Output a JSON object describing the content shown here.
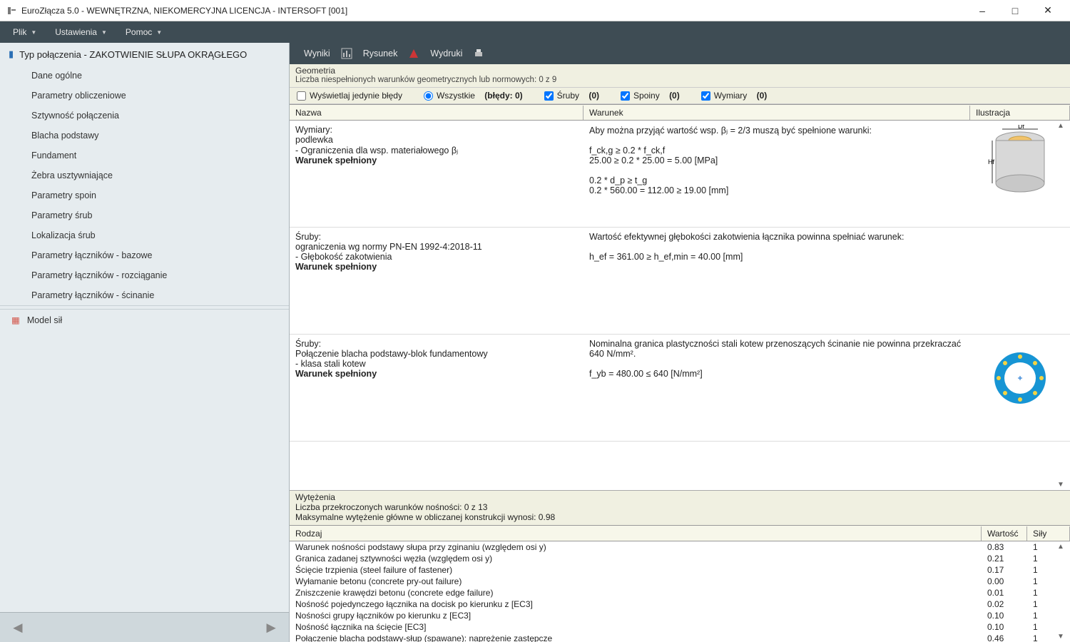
{
  "window": {
    "title": "EuroZłącza 5.0 - WEWNĘTRZNA, NIEKOMERCYJNA LICENCJA - INTERSOFT [001]"
  },
  "menubar": {
    "file": "Plik",
    "settings": "Ustawienia",
    "help": "Pomoc"
  },
  "sidebar": {
    "header": "Typ połączenia - ZAKOTWIENIE SŁUPA OKRĄGŁEGO",
    "items": [
      "Dane ogólne",
      "Parametry obliczeniowe",
      "Sztywność połączenia",
      "Blacha podstawy",
      "Fundament",
      "Żebra usztywniające",
      "Parametry spoin",
      "Parametry śrub",
      "Lokalizacja śrub",
      "Parametry łączników - bazowe",
      "Parametry łączników - rozciąganie",
      "Parametry łączników - ścinanie"
    ],
    "model": "Model sił"
  },
  "toolbar": {
    "results": "Wyniki",
    "drawing": "Rysunek",
    "printouts": "Wydruki"
  },
  "geometry": {
    "title": "Geometria",
    "unmet": "Liczba niespełnionych warunków geometrycznych lub normowych: 0 z 9"
  },
  "filters": {
    "errors_only": "Wyświetlaj jedynie błędy",
    "all": "Wszystkie",
    "errors_count": "(błędy: 0)",
    "bolts": "Śruby",
    "bolts_c": "(0)",
    "welds": "Spoiny",
    "welds_c": "(0)",
    "dims": "Wymiary",
    "dims_c": "(0)"
  },
  "columns": {
    "name": "Nazwa",
    "cond": "Warunek",
    "ill": "Ilustracja"
  },
  "rows": [
    {
      "name": "Wymiary:\npodlewka\n- Ograniczenia dla wsp. materiałowego βⱼ",
      "name_bold": "Warunek spełniony",
      "cond": "Aby można przyjąć wartość wsp. βⱼ = 2/3 muszą być spełnione warunki:\n\nf_ck,g ≥ 0.2 * f_ck,f\n25.00 ≥ 0.2 * 25.00 = 5.00 [MPa]\n\n0.2 * d_p ≥ t_g\n0.2 * 560.00 = 112.00 ≥ 19.00 [mm]",
      "ill": "cylinder"
    },
    {
      "name": "Śruby:\nograniczenia wg normy PN-EN 1992-4:2018-11\n- Głębokość zakotwienia",
      "name_bold": "Warunek spełniony",
      "cond": "Wartość efektywnej głębokości zakotwienia łącznika powinna spełniać warunek:\n\nh_ef = 361.00 ≥ h_ef,min = 40.00 [mm]",
      "ill": ""
    },
    {
      "name": "Śruby:\nPołączenie blacha podstawy-blok fundamentowy\n- klasa stali kotew",
      "name_bold": "Warunek spełniony",
      "cond": "Nominalna granica plastyczności stali kotew przenoszących ścinanie nie powinna przekraczać 640 N/mm².\n\nf_yb = 480.00 ≤ 640 [N/mm²]",
      "ill": "ring"
    }
  ],
  "wytezenia": {
    "title": "Wytężenia",
    "sub1": "Liczba przekroczonych warunków nośności: 0 z 13",
    "sub2": "Maksymalne wytężenie główne w obliczanej konstrukcji wynosi: 0.98",
    "col_r": "Rodzaj",
    "col_w": "Wartość",
    "col_s": "Siły",
    "rows": [
      {
        "r": "Warunek nośności podstawy słupa przy zginaniu (względem osi y)",
        "w": "0.83",
        "s": "1"
      },
      {
        "r": "Granica zadanej sztywności węzła (względem osi y)",
        "w": "0.21",
        "s": "1"
      },
      {
        "r": "Ścięcie trzpienia (steel failure of fastener)",
        "w": "0.17",
        "s": "1"
      },
      {
        "r": "Wyłamanie betonu (concrete pry-out failure)",
        "w": "0.00",
        "s": "1"
      },
      {
        "r": "Zniszczenie krawędzi betonu (concrete edge failure)",
        "w": "0.01",
        "s": "1"
      },
      {
        "r": "Nośność pojedynczego łącznika na docisk po kierunku z [EC3]",
        "w": "0.02",
        "s": "1"
      },
      {
        "r": "Nośności grupy łączników po kierunku z [EC3]",
        "w": "0.10",
        "s": "1"
      },
      {
        "r": "Nośność łącznika na ścięcie [EC3]",
        "w": "0.10",
        "s": "1"
      },
      {
        "r": "Połączenie blacha podstawy-słup (spawane): naprężenie zastępcze",
        "w": "0.46",
        "s": "1"
      }
    ]
  }
}
